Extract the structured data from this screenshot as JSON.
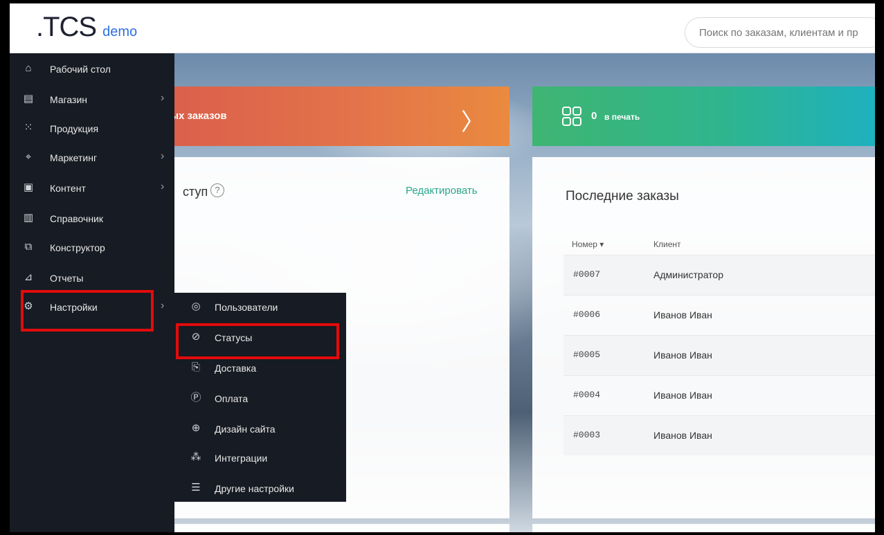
{
  "header": {
    "logo_main": ".TCS",
    "logo_sub": "demo",
    "search_placeholder": "Поиск по заказам, клиентам и пр"
  },
  "dashboard": {
    "new_orders_label": "вых заказов",
    "print_count": "0",
    "print_label": "в печать",
    "quick_access_title": "ступ",
    "quick_access_help": "?",
    "edit_link": "Редактировать",
    "recent_orders_title": "Последние заказы",
    "orders_columns": [
      "Номер ▾",
      "Клиент"
    ],
    "orders": [
      {
        "number": "#0007",
        "client": "Администратор"
      },
      {
        "number": "#0006",
        "client": "Иванов Иван"
      },
      {
        "number": "#0005",
        "client": "Иванов Иван"
      },
      {
        "number": "#0004",
        "client": "Иванов Иван"
      },
      {
        "number": "#0003",
        "client": "Иванов Иван"
      }
    ]
  },
  "sidebar": {
    "items": [
      {
        "label": "Рабочий стол",
        "icon": "home-icon",
        "has_arrow": false
      },
      {
        "label": "Магазин",
        "icon": "shop-icon",
        "has_arrow": true
      },
      {
        "label": "Продукция",
        "icon": "grid-icon",
        "has_arrow": false
      },
      {
        "label": "Маркетинг",
        "icon": "megaphone-icon",
        "has_arrow": true
      },
      {
        "label": "Контент",
        "icon": "content-icon",
        "has_arrow": true
      },
      {
        "label": "Справочник",
        "icon": "book-icon",
        "has_arrow": false
      },
      {
        "label": "Конструктор",
        "icon": "constructor-icon",
        "has_arrow": false
      },
      {
        "label": "Отчеты",
        "icon": "chart-icon",
        "has_arrow": false
      },
      {
        "label": "Настройки",
        "icon": "gear-icon",
        "has_arrow": true
      }
    ]
  },
  "submenu": {
    "items": [
      {
        "label": "Пользователи",
        "icon": "users-icon"
      },
      {
        "label": "Статусы",
        "icon": "check-circle-icon"
      },
      {
        "label": "Доставка",
        "icon": "delivery-icon"
      },
      {
        "label": "Оплата",
        "icon": "payment-icon"
      },
      {
        "label": "Дизайн сайта",
        "icon": "globe-icon"
      },
      {
        "label": "Интеграции",
        "icon": "integrations-icon"
      },
      {
        "label": "Другие настройки",
        "icon": "sliders-icon"
      }
    ]
  },
  "colors": {
    "sidebar_bg": "#171b23",
    "highlight": "#e30b0b",
    "accent_green": "#2aa58c",
    "logo_demo": "#2d6fe0"
  }
}
